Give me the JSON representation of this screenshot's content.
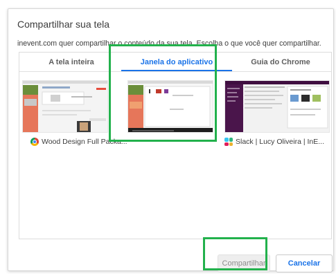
{
  "dialog": {
    "title": "Compartilhar sua tela",
    "subtitle": "inevent.com quer compartilhar o conteúdo da sua tela. Escolha o que você quer compartilhar."
  },
  "tabs": [
    {
      "label": "A tela inteira",
      "active": false
    },
    {
      "label": "Janela do aplicativo",
      "active": true
    },
    {
      "label": "Guia do Chrome",
      "active": false
    }
  ],
  "windows": [
    {
      "label": "Wood Design Full Packa...",
      "icon": "chrome-icon"
    },
    {
      "label": "",
      "icon": ""
    },
    {
      "label": "Slack | Lucy Oliveira | InE...",
      "icon": "slack-icon"
    }
  ],
  "buttons": {
    "share": "Compartilhar",
    "cancel": "Cancelar"
  },
  "colors": {
    "accent": "#1a73e8",
    "highlight": "#22b14c",
    "thumb_orange": "#e6765a",
    "slack_purple": "#4a154b"
  }
}
